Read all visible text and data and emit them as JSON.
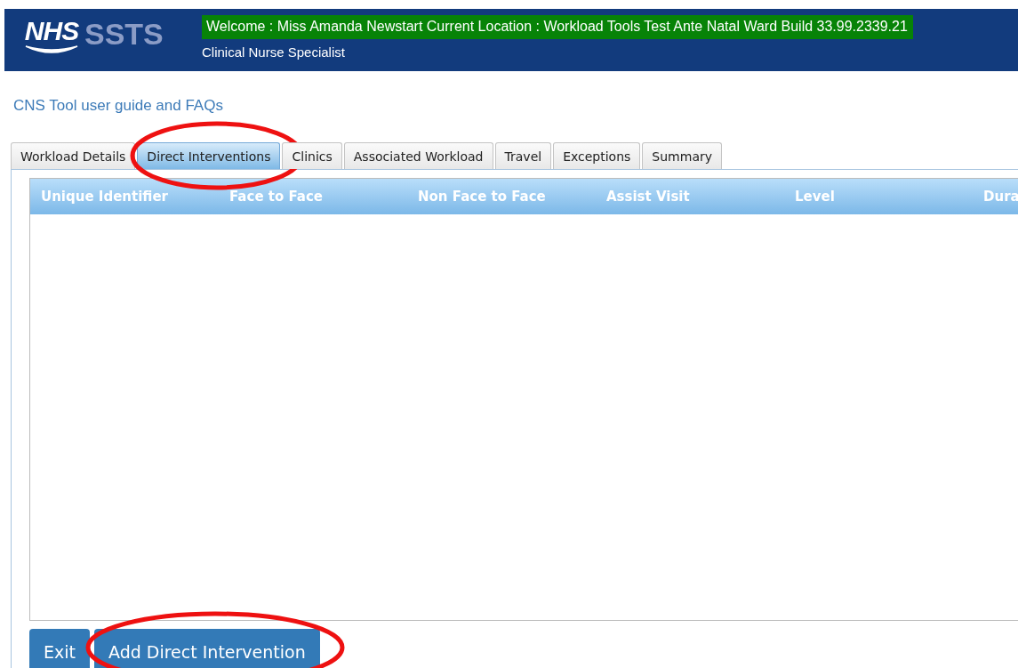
{
  "header": {
    "logo_text": "NHS",
    "app_name": "SSTS",
    "welcome": "Welcome : Miss Amanda Newstart Current Location : Workload Tools Test Ante Natal Ward Build 33.99.2339.21",
    "role": "Clinical Nurse Specialist"
  },
  "guide_link": "CNS Tool user guide and FAQs",
  "tabs": [
    {
      "label": "Workload Details",
      "selected": false,
      "circled": false
    },
    {
      "label": "Direct Interventions",
      "selected": true,
      "circled": true
    },
    {
      "label": "Clinics",
      "selected": false,
      "circled": false
    },
    {
      "label": "Associated Workload",
      "selected": false,
      "circled": false
    },
    {
      "label": "Travel",
      "selected": false,
      "circled": false
    },
    {
      "label": "Exceptions",
      "selected": false,
      "circled": false
    },
    {
      "label": "Summary",
      "selected": false,
      "circled": false
    }
  ],
  "table": {
    "columns": [
      "Unique Identifier",
      "Face to Face",
      "Non Face to Face",
      "Assist Visit",
      "Level",
      "Dura"
    ]
  },
  "buttons": [
    {
      "label": "Exit",
      "circled": false
    },
    {
      "label": "Add Direct Intervention",
      "circled": true
    }
  ]
}
